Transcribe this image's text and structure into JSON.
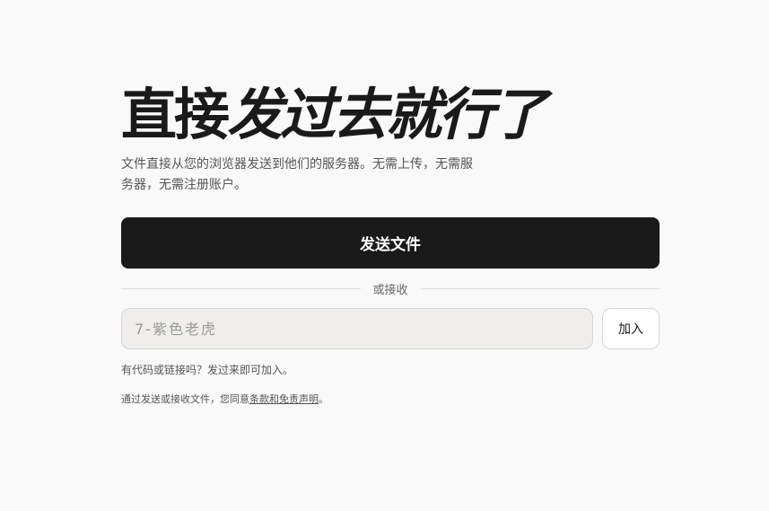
{
  "hero": {
    "title_upright": "直接",
    "title_italic": "发过去就行了",
    "subtitle": "文件直接从您的浏览器发送到他们的服务器。无需上传，无需服务器，无需注册账户。"
  },
  "actions": {
    "send_label": "发送文件",
    "divider_label": "或接收"
  },
  "join": {
    "code_placeholder": "7-紫色老虎",
    "code_value": "",
    "join_label": "加入",
    "hint": "有代码或链接吗？发过来即可加入。"
  },
  "legal": {
    "prefix": "通过发送或接收文件，您同意",
    "link_label": "条款和免责声明",
    "suffix": "。"
  },
  "colors": {
    "background": "#f9f9f9",
    "primary_button": "#1a1a1a",
    "input_background": "#efeeec"
  }
}
